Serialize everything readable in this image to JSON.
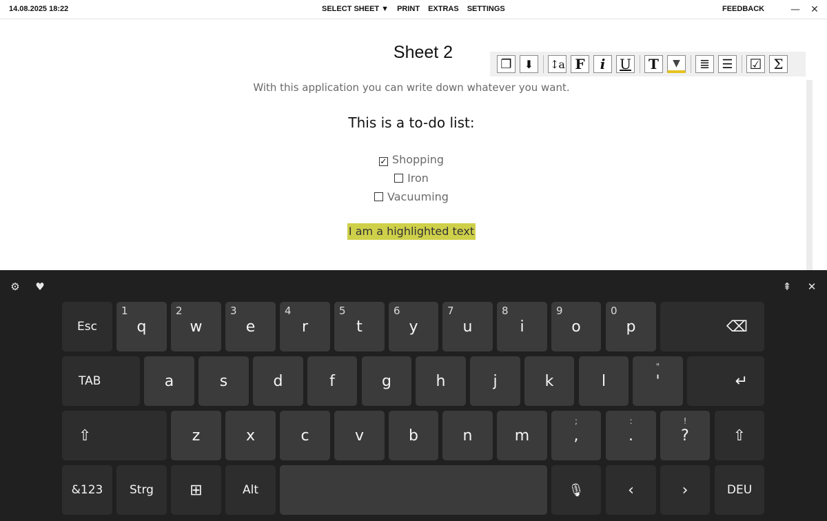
{
  "topbar": {
    "datetime": "14.08.2025 18:22",
    "menu": [
      "SELECT SHEET ▼",
      "PRINT",
      "EXTRAS",
      "SETTINGS"
    ],
    "feedback": "FEEDBACK",
    "minimize_glyph": "—",
    "close_glyph": "✕"
  },
  "document": {
    "title": "Sheet 2",
    "intro": "With this application you can write down whatever you want.",
    "heading": "This is a to-do list:",
    "todos": [
      {
        "label": "Shopping",
        "checked": true
      },
      {
        "label": "Iron",
        "checked": false
      },
      {
        "label": "Vacuuming",
        "checked": false
      }
    ],
    "highlight_text": "I am a highlighted text",
    "highlight_color": "#cfd04a"
  },
  "toolbar": {
    "buttons": [
      {
        "name": "copy-format-icon",
        "glyph": "❐"
      },
      {
        "name": "download-icon",
        "glyph": "⬇"
      },
      {
        "name": "font-size-icon",
        "glyph": "↕a"
      },
      {
        "name": "bold-icon",
        "glyph": "F"
      },
      {
        "name": "italic-icon",
        "glyph": "i"
      },
      {
        "name": "underline-icon",
        "glyph": "U"
      },
      {
        "name": "text-style-icon",
        "glyph": "T"
      },
      {
        "name": "highlighter-icon",
        "glyph": "▼"
      },
      {
        "name": "align-center-icon",
        "glyph": "≣"
      },
      {
        "name": "bullet-list-icon",
        "glyph": "☰"
      },
      {
        "name": "checkbox-icon",
        "glyph": "☑"
      },
      {
        "name": "sum-icon",
        "glyph": "Σ"
      }
    ]
  },
  "keyboard": {
    "settings_glyph": "⚙",
    "emoji_glyph": "♥",
    "dock_glyph": "⇞",
    "close_glyph": "✕",
    "row1": [
      {
        "label": "Esc"
      },
      {
        "label": "q",
        "num": "1"
      },
      {
        "label": "w",
        "num": "2"
      },
      {
        "label": "e",
        "num": "3"
      },
      {
        "label": "r",
        "num": "4"
      },
      {
        "label": "t",
        "num": "5"
      },
      {
        "label": "y",
        "num": "6"
      },
      {
        "label": "u",
        "num": "7"
      },
      {
        "label": "i",
        "num": "8"
      },
      {
        "label": "o",
        "num": "9"
      },
      {
        "label": "p",
        "num": "0"
      },
      {
        "label": "⌫"
      }
    ],
    "row2": [
      {
        "label": "TAB"
      },
      {
        "label": "a"
      },
      {
        "label": "s"
      },
      {
        "label": "d"
      },
      {
        "label": "f"
      },
      {
        "label": "g"
      },
      {
        "label": "h"
      },
      {
        "label": "j"
      },
      {
        "label": "k"
      },
      {
        "label": "l"
      },
      {
        "label": "'",
        "sup": "\""
      },
      {
        "label": "↵"
      }
    ],
    "row3": [
      {
        "label": "⇧"
      },
      {
        "label": "z"
      },
      {
        "label": "x"
      },
      {
        "label": "c"
      },
      {
        "label": "v"
      },
      {
        "label": "b"
      },
      {
        "label": "n"
      },
      {
        "label": "m"
      },
      {
        "label": ",",
        "sup": ";"
      },
      {
        "label": ".",
        "sup": ":"
      },
      {
        "label": "?",
        "sup": "!"
      },
      {
        "label": "⇧"
      }
    ],
    "row4": [
      {
        "label": "&123"
      },
      {
        "label": "Strg"
      },
      {
        "label": "⊞"
      },
      {
        "label": "Alt"
      },
      {
        "label": ""
      },
      {
        "label": "🎙"
      },
      {
        "label": "‹"
      },
      {
        "label": "›"
      },
      {
        "label": "DEU"
      }
    ]
  }
}
